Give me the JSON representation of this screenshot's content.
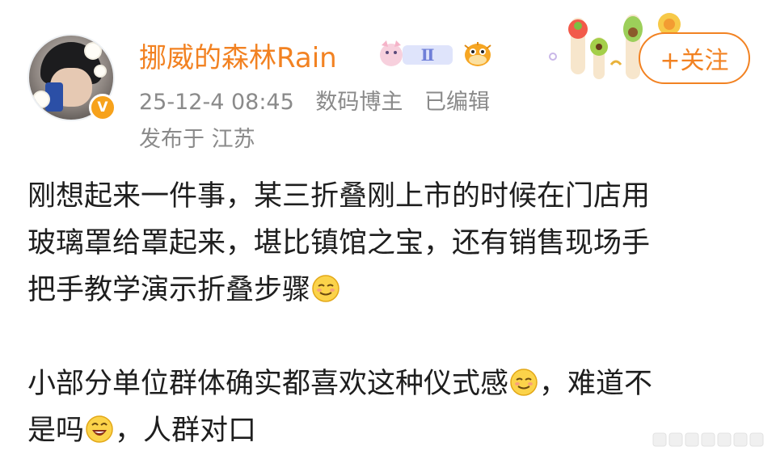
{
  "post": {
    "author": {
      "name": "挪威的森林Rain",
      "verified_icon": "verified-badge-icon",
      "level_badge_text": "Ⅱ"
    },
    "timestamp": "25-12-4 08:45",
    "role": "数码博主",
    "edited": "已编辑",
    "location": "发布于 江苏",
    "follow_label": "+关注",
    "content": {
      "line1": "刚想起来一件事，某三折叠刚上市的时候在门店用",
      "line2": "玻璃罩给罩起来，堪比镇馆之宝，还有销售现场手",
      "line3": "把手教学演示折叠步骤",
      "line4a": "小部分单位群体确实都喜欢这种仪式感",
      "line4b": "，难道不",
      "line5a": "是吗",
      "line5b": "，人群对口"
    }
  },
  "colors": {
    "accent": "#f28222",
    "meta_text": "#8a8a8a",
    "body_text": "#1e1e1e",
    "verified": "#f7a21b"
  },
  "icons": {
    "emoji_smirk": "smirk-emoji-icon",
    "emoji_laugh": "laugh-emoji-icon",
    "fish_badge": "puffer-fish-badge-icon"
  }
}
